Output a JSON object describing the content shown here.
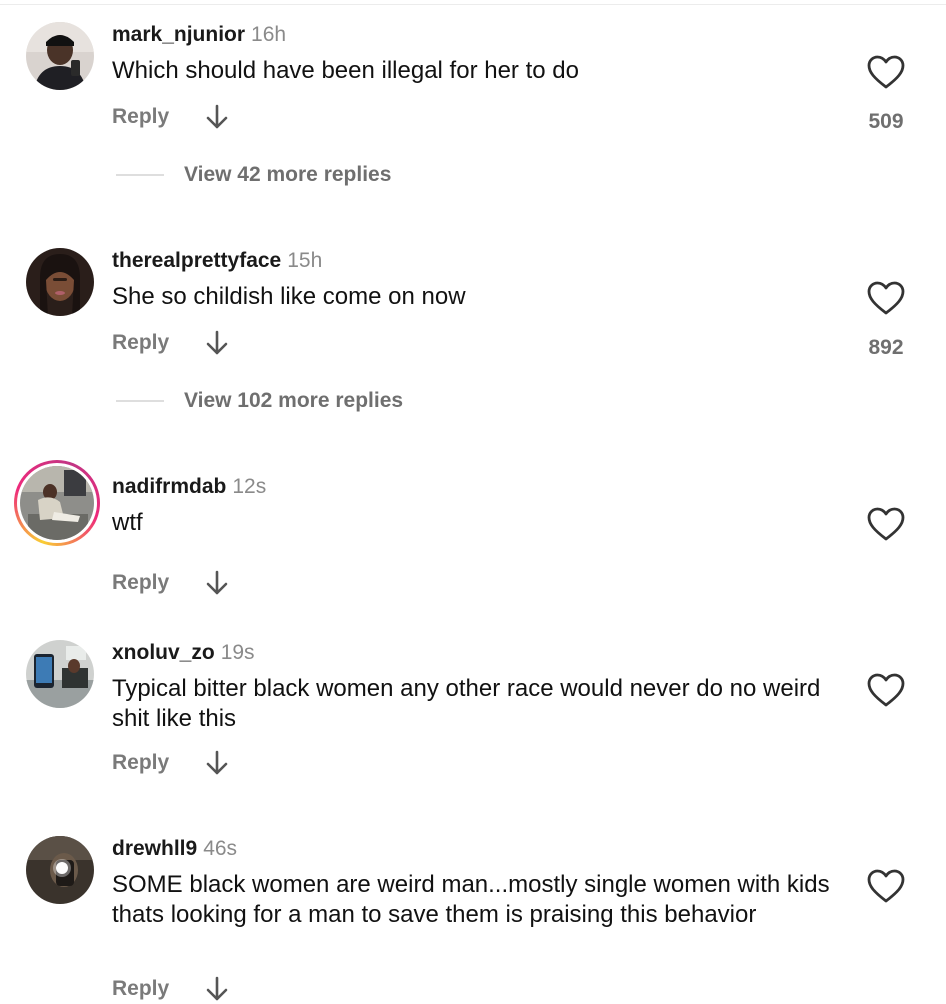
{
  "comments": [
    {
      "username": "mark_njunior",
      "time": "16h",
      "text": "Which should have been illegal for her to do",
      "reply_label": "Reply",
      "likes": "509",
      "view_replies": "View 42 more replies",
      "avatar_icon": "avatar-photo"
    },
    {
      "username": "therealprettyface",
      "time": "15h",
      "text": "She so childish like come on now",
      "reply_label": "Reply",
      "likes": "892",
      "view_replies": "View 102 more replies",
      "avatar_icon": "avatar-photo"
    },
    {
      "username": "nadifrmdab",
      "time": "12s",
      "text": "wtf",
      "reply_label": "Reply",
      "has_story_ring": true,
      "avatar_icon": "avatar-photo"
    },
    {
      "username": "xnoluv_zo",
      "time": "19s",
      "text": "Typical bitter black women any other race would never do no weird shit like this",
      "reply_label": "Reply",
      "avatar_icon": "avatar-photo"
    },
    {
      "username": "drewhll9",
      "time": "46s",
      "text": "SOME black women are weird man...mostly single women with kids thats looking for a man to save them is praising this behavior",
      "reply_label": "Reply",
      "avatar_icon": "avatar-photo"
    }
  ],
  "icons": {
    "like": "heart-outline-icon",
    "reply_arrow": "arrow-down-icon"
  },
  "colors": {
    "story_ring_start": "#f9ce34",
    "story_ring_mid": "#ee2a7b",
    "secondary_text": "#8a8a8a"
  }
}
